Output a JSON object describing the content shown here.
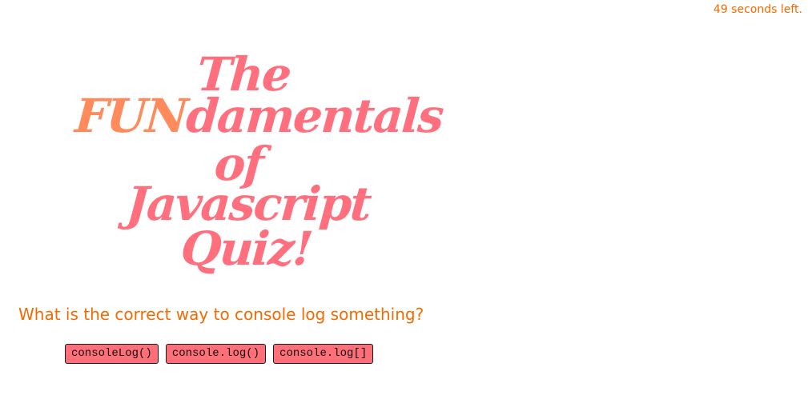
{
  "timer": {
    "text": "49 seconds left."
  },
  "logo": {
    "line1": "The",
    "line2_highlight": "FUN",
    "line2_rest": "damentals",
    "line3": "of",
    "line4": "Javascript",
    "line5": "Quiz!"
  },
  "question": {
    "text": "What is the correct way to console log something?"
  },
  "answers": [
    {
      "label": "consoleLog()"
    },
    {
      "label": "console.log()"
    },
    {
      "label": "console.log[]"
    }
  ],
  "colors": {
    "accent": "#f56a00",
    "logo_pink": "#ff6f7d",
    "logo_orange": "#ff8b5c",
    "button_bg": "#ff6f7a"
  }
}
